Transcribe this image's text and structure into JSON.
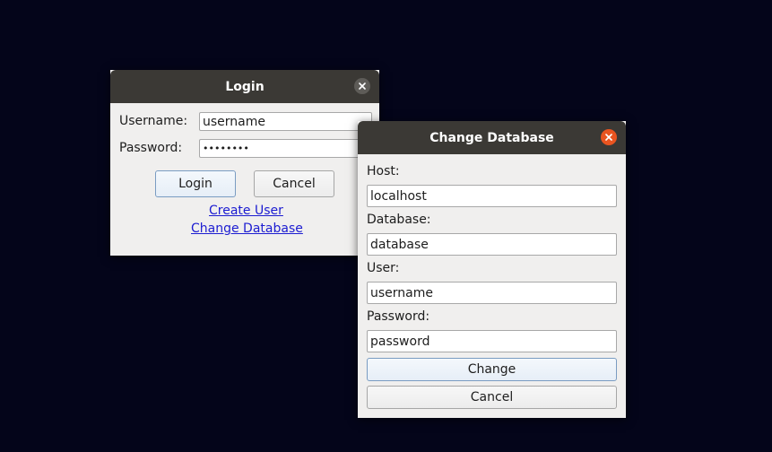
{
  "login_window": {
    "title": "Login",
    "username_label": "Username:",
    "username_value": "username",
    "password_label": "Password:",
    "password_value": "••••••••",
    "login_button": "Login",
    "cancel_button": "Cancel",
    "create_user_link": "Create User",
    "change_database_link": "Change Database"
  },
  "change_db_window": {
    "title": "Change Database",
    "host_label": "Host:",
    "host_value": "localhost",
    "database_label": "Database:",
    "database_value": "database",
    "user_label": "User:",
    "user_value": "username",
    "password_label": "Password:",
    "password_value": "password",
    "change_button": "Change",
    "cancel_button": "Cancel"
  },
  "colors": {
    "desktop_background": "#04051a",
    "titlebar": "#3b3935",
    "active_close_button": "#e95420",
    "inactive_close_button": "#5e5c58"
  },
  "icons": {
    "close": "close-icon"
  }
}
